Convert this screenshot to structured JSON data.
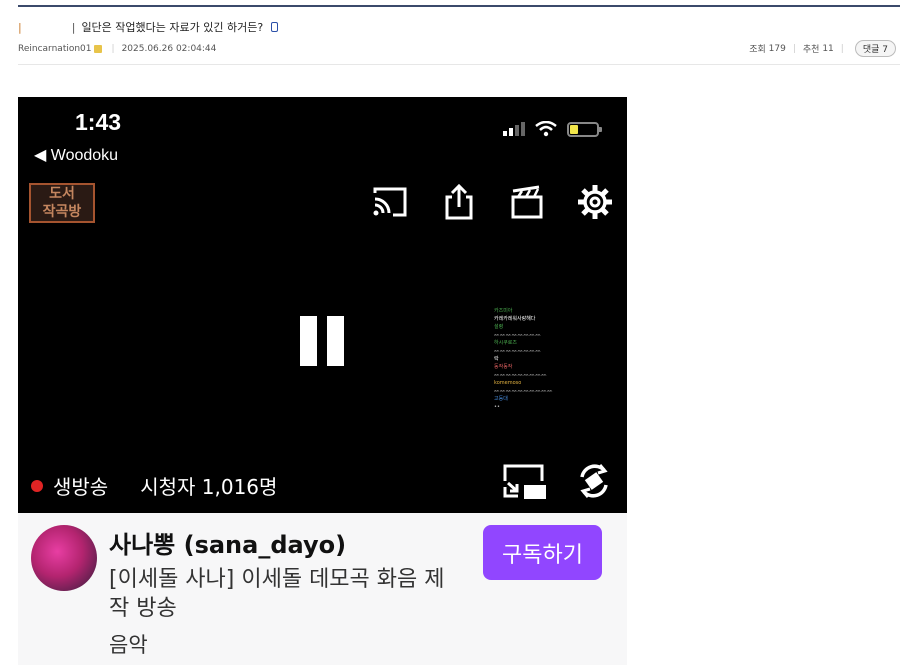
{
  "post": {
    "category_marker": "|",
    "title_separator": "|",
    "title": "일단은 작업했다는 자료가 있긴 하거든?",
    "author": "Reincarnation01",
    "datetime": "2025.06.26 02:04:44",
    "views_label": "조회",
    "views": "179",
    "recommend_label": "추천",
    "recommend": "11",
    "comments_label": "댓글",
    "comments": "7"
  },
  "screenshot": {
    "clock": "1:43",
    "back_label": "◀ Woodoku",
    "logo_text_top": "도서",
    "logo_text_bottom": "작곡방",
    "live_label": "생방송",
    "viewers_label": "시청자 1,016명",
    "chat_lines": [
      {
        "text": "카즈미아",
        "color": "#4caf50"
      },
      {
        "text": "카레카레워사랑해다",
        "color": "#ffffff"
      },
      {
        "text": "설령",
        "color": "#4caf50"
      },
      {
        "text": "ᨐᨐᨐᨐᨐᨐᨐᨐ",
        "color": "#bbbbbb"
      },
      {
        "text": "하시쿠로즈",
        "color": "#4caf50"
      },
      {
        "text": "ᨐᨐᨐᨐᨐᨐᨐᨐ",
        "color": "#bbbbbb"
      },
      {
        "text": "락",
        "color": "#ffffff"
      },
      {
        "text": "동작동작",
        "color": "#e06060"
      },
      {
        "text": "ᨐᨐᨐᨐᨐᨐᨐᨐᨐ",
        "color": "#bbbbbb"
      },
      {
        "text": "komemoso",
        "color": "#e0b040"
      },
      {
        "text": "ᨐᨐᨐᨐᨐᨐᨐᨐᨐᨐ",
        "color": "#bbbbbb"
      },
      {
        "text": "고등대",
        "color": "#4a90e2"
      },
      {
        "text": "••",
        "color": "#bbbbbb"
      }
    ],
    "channel_name": "사나뽕 (sana_dayo)",
    "stream_title": "[이세돌 사나] 이세돌 데모곡 화음 제작 방송",
    "category": "음악",
    "subscribe_label": "구독하기"
  }
}
